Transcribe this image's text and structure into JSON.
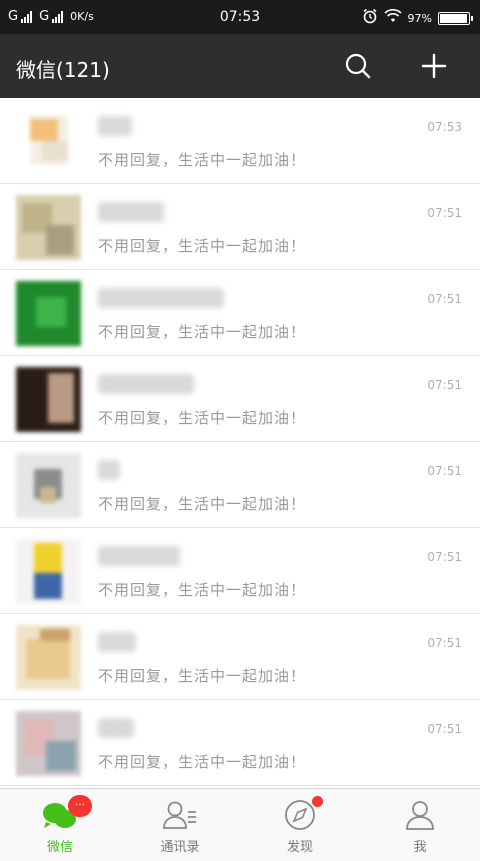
{
  "status_bar": {
    "carrier1": "G",
    "carrier2": "G",
    "speed": "0K/s",
    "time": "07:53",
    "battery": "97%",
    "battery_level": 0.97
  },
  "header": {
    "title": "微信(121)"
  },
  "chats": [
    {
      "preview": "不用回复，生活中一起加油！",
      "time": "07:53"
    },
    {
      "preview": "不用回复，生活中一起加油！",
      "time": "07:51"
    },
    {
      "preview": "不用回复，生活中一起加油！",
      "time": "07:51"
    },
    {
      "preview": "不用回复，生活中一起加油！",
      "time": "07:51"
    },
    {
      "preview": "不用回复，生活中一起加油！",
      "time": "07:51"
    },
    {
      "preview": "不用回复，生活中一起加油！",
      "time": "07:51"
    },
    {
      "preview": "不用回复，生活中一起加油！",
      "time": "07:51"
    },
    {
      "preview": "不用回复，生活中一起加油！",
      "time": "07:51"
    }
  ],
  "tabs": [
    {
      "label": "微信",
      "icon": "chat-bubbles-icon",
      "badge": "...",
      "active": true
    },
    {
      "label": "通讯录",
      "icon": "contacts-icon"
    },
    {
      "label": "发现",
      "icon": "compass-icon",
      "dot": true
    },
    {
      "label": "我",
      "icon": "person-icon"
    }
  ],
  "colors": {
    "status_bg": "#1b1b1b",
    "title_bg": "#2e2e2e",
    "accent_green": "#45c01a",
    "badge_red": "#f43530"
  }
}
